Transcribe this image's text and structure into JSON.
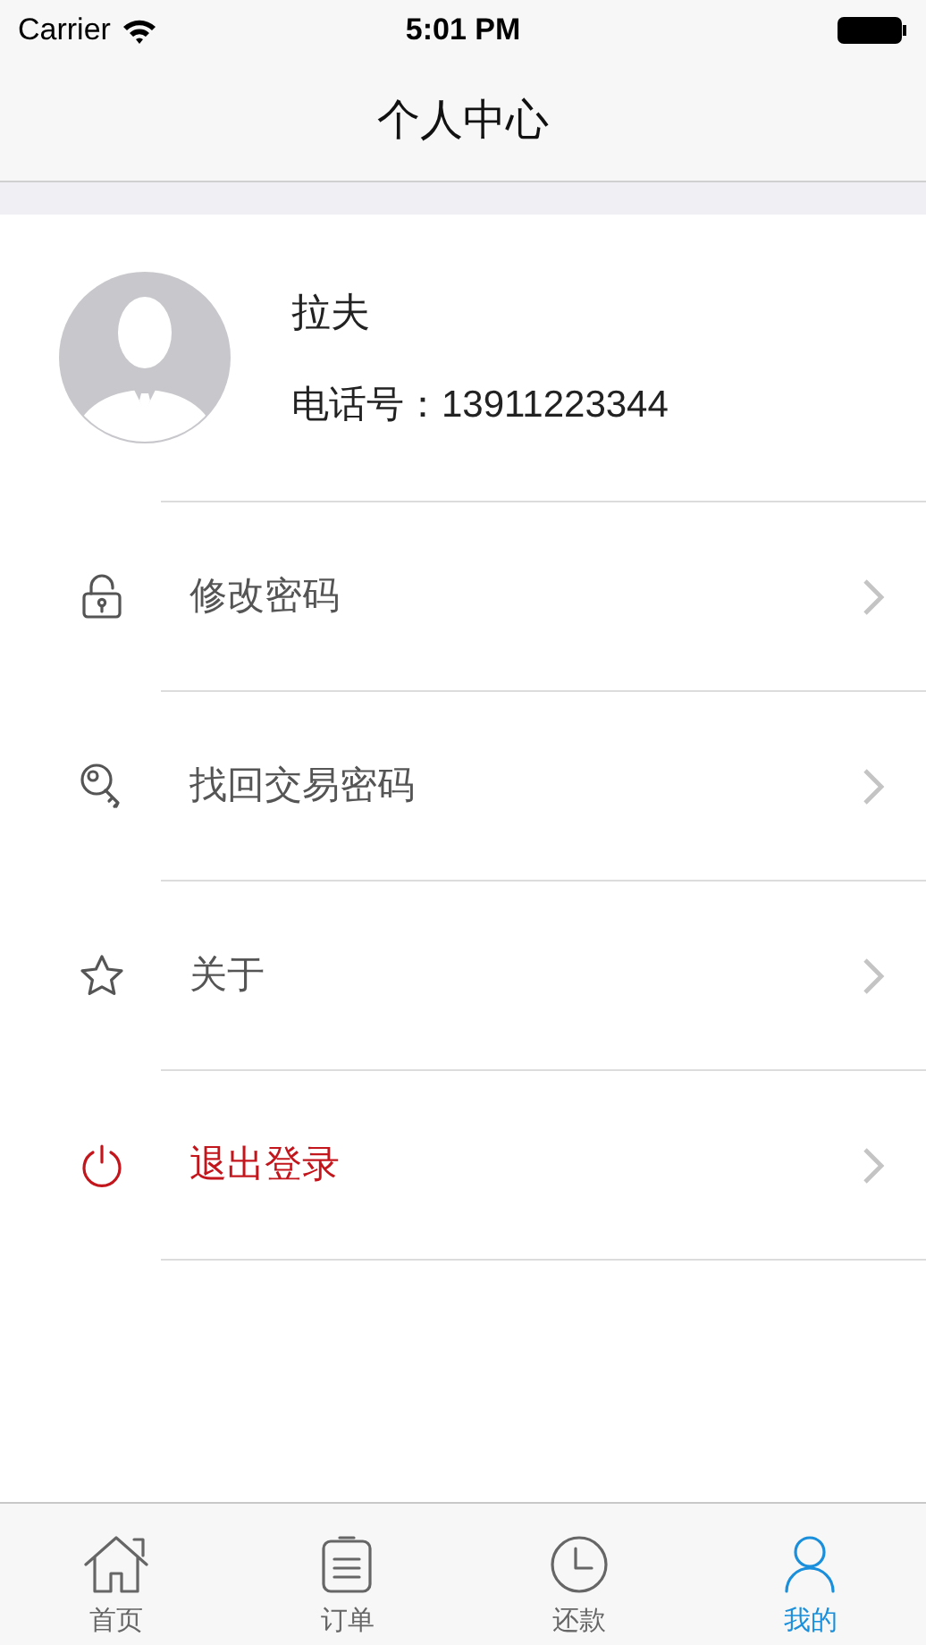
{
  "status_bar": {
    "carrier": "Carrier",
    "time": "5:01 PM"
  },
  "nav_bar": {
    "title": "个人中心"
  },
  "profile": {
    "name": "拉夫",
    "phone": "电话号：13911223344"
  },
  "menu": [
    {
      "label": "修改密码",
      "kind": "link"
    },
    {
      "label": "找回交易密码",
      "kind": "link"
    },
    {
      "label": "关于",
      "kind": "link"
    },
    {
      "label": "退出登录",
      "kind": "logout"
    }
  ],
  "tabs": [
    {
      "label": "首页",
      "selected": false
    },
    {
      "label": "订单",
      "selected": false
    },
    {
      "label": "还款",
      "selected": false
    },
    {
      "label": "我的",
      "selected": true
    }
  ]
}
